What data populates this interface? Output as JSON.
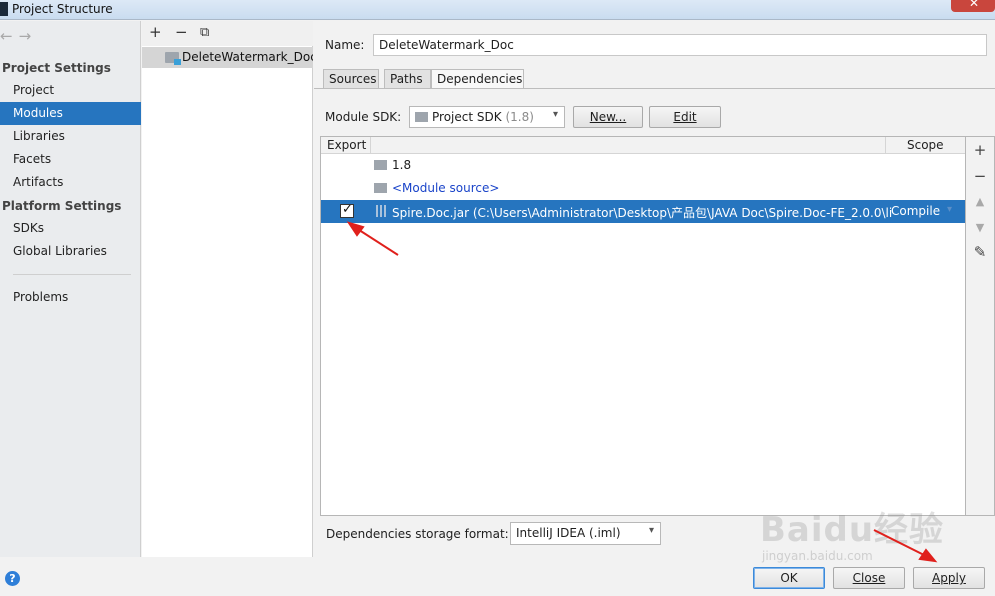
{
  "window": {
    "title": "Project Structure",
    "close_glyph": "✕"
  },
  "nav": {
    "back": "←",
    "forward": "→",
    "project_settings_heading": "Project Settings",
    "project_settings_items": [
      "Project",
      "Modules",
      "Libraries",
      "Facets",
      "Artifacts"
    ],
    "selected_item": "Modules",
    "platform_settings_heading": "Platform Settings",
    "platform_settings_items": [
      "SDKs",
      "Global Libraries"
    ],
    "problems": "Problems"
  },
  "modules": {
    "toolbar": {
      "add": "+",
      "remove": "−",
      "copy": "⧉"
    },
    "items": [
      "DeleteWatermark_Doc"
    ]
  },
  "module": {
    "name_label": "Name:",
    "name_value": "DeleteWatermark_Doc",
    "tabs": [
      "Sources",
      "Paths",
      "Dependencies"
    ],
    "active_tab": "Dependencies",
    "sdk_label": "Module SDK:",
    "sdk_value": "Project SDK",
    "sdk_version": "(1.8)",
    "new_button": "New...",
    "edit_button": "Edit"
  },
  "dependencies": {
    "col_export": "Export",
    "col_scope": "Scope",
    "rows": [
      {
        "text": "1.8",
        "type": "sdk"
      },
      {
        "text": "<Module source>",
        "type": "source"
      },
      {
        "text": "Spire.Doc.jar (C:\\Users\\Administrator\\Desktop\\产品包\\JAVA Doc\\Spire.Doc-FE_2.0.0\\li",
        "type": "jar",
        "exported": true,
        "scope": "Compile",
        "selected": true
      }
    ],
    "side_tools": {
      "add": "+",
      "remove": "−",
      "up": "▲",
      "down": "▼",
      "edit": "✎"
    },
    "storage_format_label": "Dependencies storage format:",
    "storage_format_value": "IntelliJ IDEA (.iml)"
  },
  "footer": {
    "help": "?",
    "ok": "OK",
    "close": "Close",
    "apply": "Apply"
  },
  "watermark": {
    "main": "Baidu经验",
    "sub": "jingyan.baidu.com"
  },
  "colors": {
    "selection": "#2675bf",
    "annotation": "#e0201c",
    "link": "#1a44c9"
  }
}
